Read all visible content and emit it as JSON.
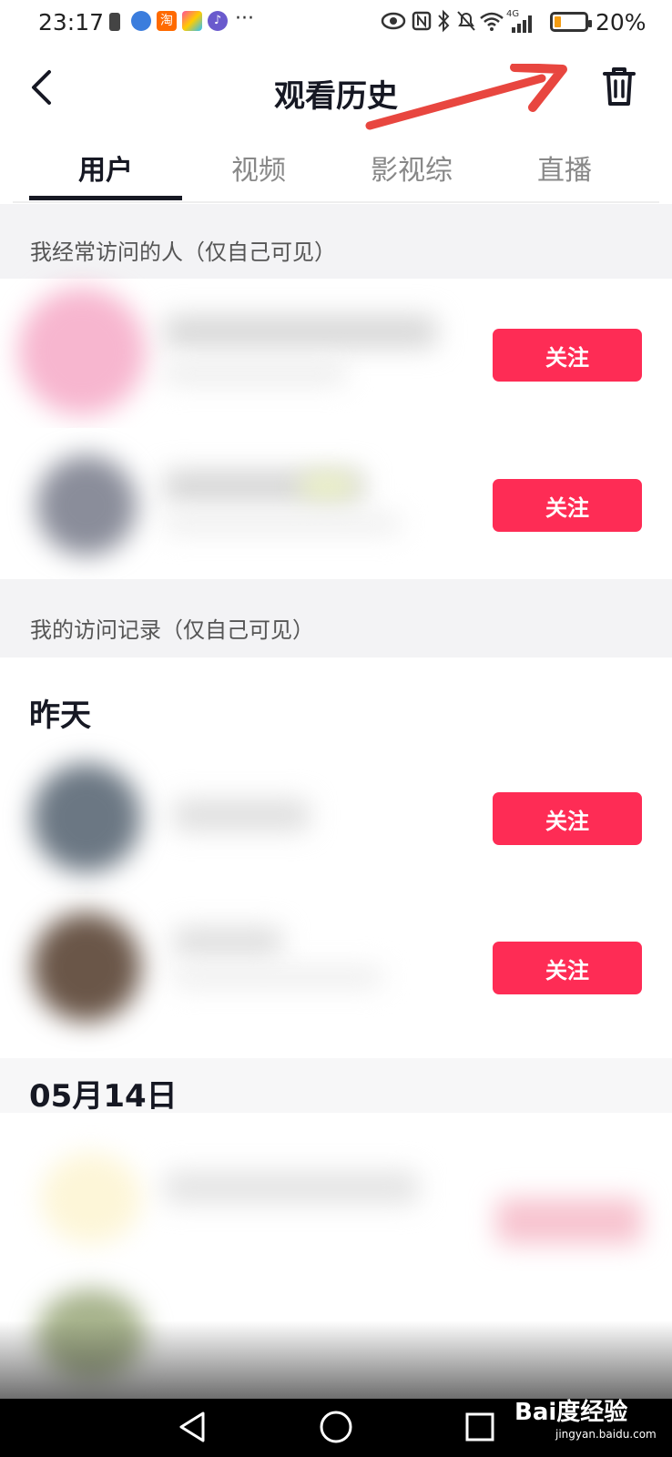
{
  "status_bar": {
    "time": "23:17",
    "battery": "20%",
    "network": "4G",
    "app_icons": [
      "bookmark-icon",
      "browser-icon",
      "taobao-icon",
      "colorful-app-icon",
      "music-icon"
    ],
    "more": "···"
  },
  "header": {
    "title": "观看历史",
    "back_icon": "back-chevron-icon",
    "delete_icon": "trash-icon",
    "annotation_color": "#e8463f"
  },
  "tabs": [
    {
      "label": "用户",
      "active": true
    },
    {
      "label": "视频",
      "active": false
    },
    {
      "label": "影视综",
      "active": false
    },
    {
      "label": "直播",
      "active": false
    }
  ],
  "sections": {
    "frequent": {
      "label": "我经常访问的人（仅自己可见）"
    },
    "records": {
      "label": "我的访问记录（仅自己可见）"
    }
  },
  "dates": {
    "yesterday": "昨天",
    "may14": "05月14日"
  },
  "follow_label": "关注",
  "colors": {
    "accent": "#fe2c55",
    "section_bg": "#f3f3f5"
  },
  "watermark": {
    "text": "Bai度经验",
    "sub": "jingyan.baidu.com"
  }
}
